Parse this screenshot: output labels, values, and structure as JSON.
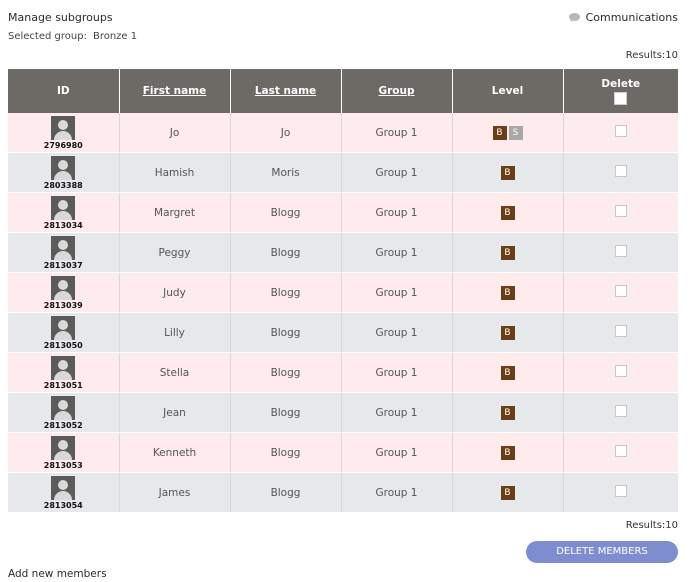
{
  "header": {
    "title": "Manage subgroups",
    "selected_label": "Selected group:",
    "selected_value": "Bronze 1",
    "communications": "Communications"
  },
  "results_top": "Results:10",
  "results_bottom": "Results:10",
  "columns": {
    "id": "ID",
    "first_name": "First name",
    "last_name": "Last name",
    "group": "Group",
    "level": "Level",
    "delete": "Delete"
  },
  "rows": [
    {
      "id": "2796980",
      "first": "Jo",
      "last": "Jo",
      "group": "Group 1",
      "levels": [
        "B",
        "S"
      ]
    },
    {
      "id": "2803388",
      "first": "Hamish",
      "last": "Moris",
      "group": "Group 1",
      "levels": [
        "B"
      ]
    },
    {
      "id": "2813034",
      "first": "Margret",
      "last": "Blogg",
      "group": "Group 1",
      "levels": [
        "B"
      ]
    },
    {
      "id": "2813037",
      "first": "Peggy",
      "last": "Blogg",
      "group": "Group 1",
      "levels": [
        "B"
      ]
    },
    {
      "id": "2813039",
      "first": "Judy",
      "last": "Blogg",
      "group": "Group 1",
      "levels": [
        "B"
      ]
    },
    {
      "id": "2813050",
      "first": "Lilly",
      "last": "Blogg",
      "group": "Group 1",
      "levels": [
        "B"
      ]
    },
    {
      "id": "2813051",
      "first": "Stella",
      "last": "Blogg",
      "group": "Group 1",
      "levels": [
        "B"
      ]
    },
    {
      "id": "2813052",
      "first": "Jean",
      "last": "Blogg",
      "group": "Group 1",
      "levels": [
        "B"
      ]
    },
    {
      "id": "2813053",
      "first": "Kenneth",
      "last": "Blogg",
      "group": "Group 1",
      "levels": [
        "B"
      ]
    },
    {
      "id": "2813054",
      "first": "James",
      "last": "Blogg",
      "group": "Group 1",
      "levels": [
        "B"
      ]
    }
  ],
  "delete_button": "DELETE MEMBERS",
  "add_new": "Add new members",
  "colors": {
    "header_bg": "#6d6a66",
    "row_odd": "#fdebee",
    "row_even": "#e6e8ec",
    "level_bronze": "#6b3e16",
    "level_silver": "#a8a8a8",
    "button": "#7e8dd0"
  },
  "icons": {
    "communications": "speech-bubble-icon",
    "avatar": "user-avatar-icon"
  }
}
